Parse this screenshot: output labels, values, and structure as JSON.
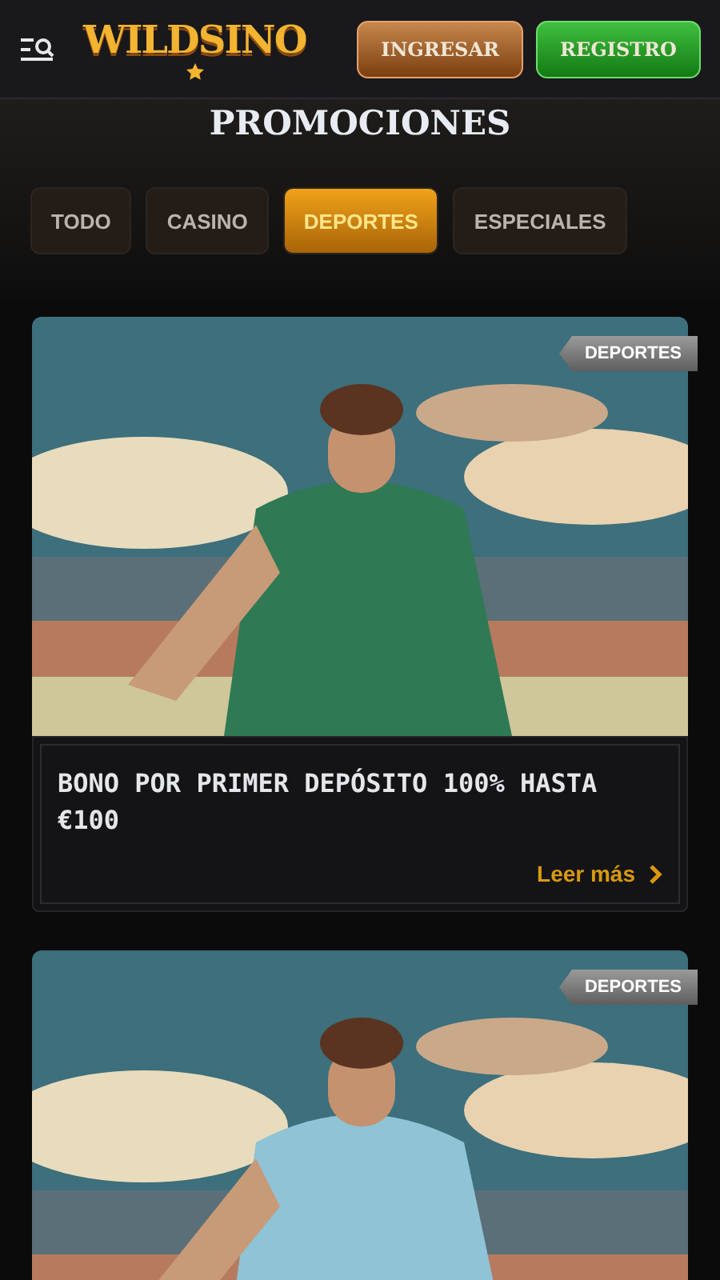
{
  "header": {
    "logo": "WILDSINO",
    "buttons": [
      {
        "label": "INGRESAR",
        "kind": "login"
      },
      {
        "label": "REGISTRO",
        "kind": "signup"
      }
    ]
  },
  "title": "PROMOCIONES",
  "tabs": [
    {
      "label": "TODO",
      "selected": false
    },
    {
      "label": "CASINO",
      "selected": false
    },
    {
      "label": "DEPORTES",
      "selected": true
    },
    {
      "label": "ESPECIALES",
      "selected": false
    }
  ],
  "promotions": [
    {
      "tag": "DEPORTES",
      "title": "BONO POR PRIMER DEPÓSITO 100% HASTA €100",
      "link": "Leer más"
    },
    {
      "tag": "DEPORTES"
    }
  ]
}
